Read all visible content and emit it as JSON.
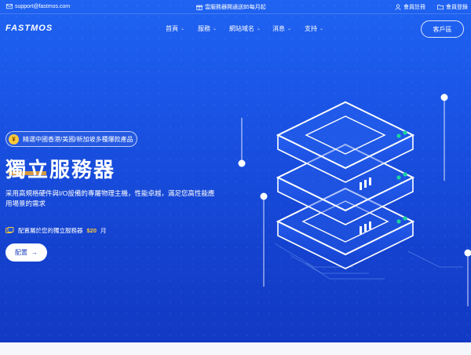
{
  "topbar": {
    "email": "support@fastmos.com",
    "promo": "雲服務器開通送$5每月起",
    "register": "會員註冊",
    "login": "會員登錄"
  },
  "brand": {
    "logo_text": "FASTMOS"
  },
  "nav": {
    "items": [
      {
        "label": "首頁"
      },
      {
        "label": "服務"
      },
      {
        "label": "網站域名"
      },
      {
        "label": "消息"
      },
      {
        "label": "支持"
      }
    ],
    "client_button": "客戶區"
  },
  "hero": {
    "badge_icon": "¥",
    "badge": "精選中國香港/美國/新加坡多種爆款產品",
    "title": "獨立服務器",
    "description": "采用高規格硬件與I/O設備的專屬物理主機，性能卓越，滿足您高性能應用場景的需求",
    "price_prefix": "配置屬於您的獨立服務器",
    "price": "$20",
    "price_unit": "月",
    "button": "配置",
    "button_arrow": "→"
  },
  "colors": {
    "background_top": "#1f63f2",
    "background_bottom": "#1138c2",
    "accent": "#ffc93c",
    "server_led": "#19d3a2"
  },
  "icons": {
    "email": "mail-icon",
    "promo": "gift-icon",
    "register": "user-icon",
    "login": "folder-icon",
    "price": "coin-icon"
  }
}
